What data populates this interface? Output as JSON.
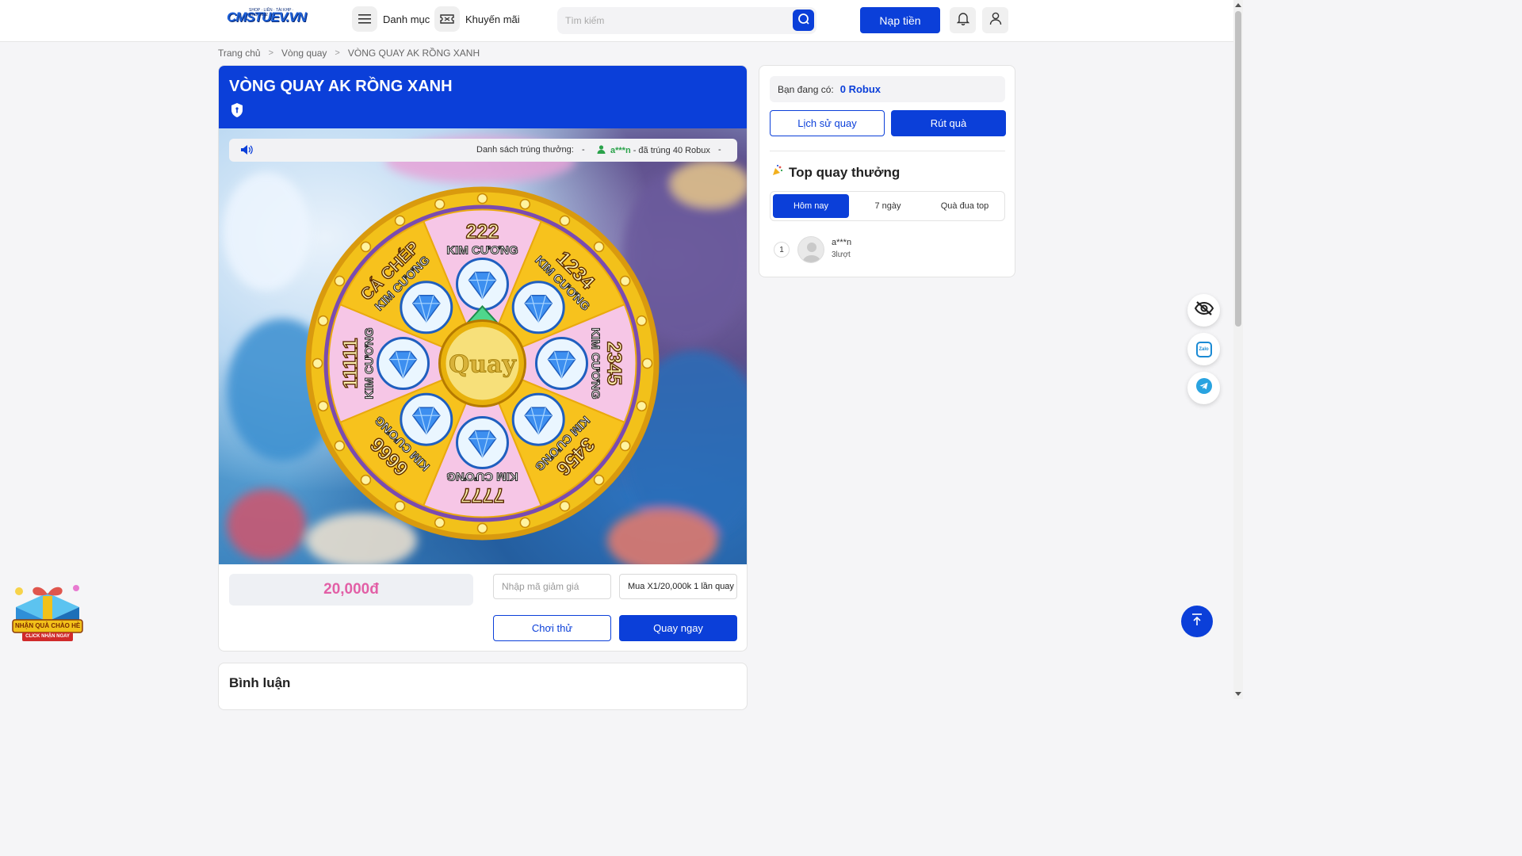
{
  "header": {
    "logo_text": "CMSTUEV.VN",
    "logo_sub": "SHOP · LIÊN · TÀI KHP · CHỢ 2022",
    "menu_label": "Danh mục",
    "promo_label": "Khuyến mãi",
    "search_placeholder": "Tìm kiếm",
    "topup_label": "Nạp tiền",
    "icons": [
      "menu-icon",
      "ticket-icon",
      "search-icon",
      "bell-icon",
      "user-icon"
    ]
  },
  "breadcrumb": {
    "items": [
      "Trang chủ",
      "Vòng quay",
      "VÒNG QUAY AK RỒNG XANH"
    ]
  },
  "main": {
    "title": "VÒNG QUAY AK RỒNG XANH",
    "ticker": {
      "label": "Danh sách trúng thưởng:",
      "dash": "-",
      "winner": "a***n",
      "prize_text": "- đã trúng 40 Robux"
    },
    "wheel": {
      "center_label": "Quay",
      "segments": [
        {
          "amount": "222",
          "unit": "KIM CƯƠNG",
          "color": "pink"
        },
        {
          "amount": "1234",
          "unit": "KIM CƯƠNG",
          "color": "yellow"
        },
        {
          "amount": "2345",
          "unit": "KIM CƯƠNG",
          "color": "pink"
        },
        {
          "amount": "3456",
          "unit": "KIM CƯƠNG",
          "color": "yellow"
        },
        {
          "amount": "7777",
          "unit": "KIM CƯƠNG",
          "color": "pink"
        },
        {
          "amount": "6666",
          "unit": "KIM CƯƠNG",
          "color": "yellow"
        },
        {
          "amount": "11111",
          "unit": "KIM CƯƠNG",
          "color": "pink"
        },
        {
          "amount": "CÁ CHÉP",
          "unit": "KIM CƯƠNG",
          "color": "yellow"
        }
      ],
      "colors": {
        "pink": "#f6c6e6",
        "yellow": "#f7c21d",
        "rim": "#f2c11a"
      }
    },
    "price": "20,000đ",
    "coupon_placeholder": "Nhập mã giảm giá",
    "buy_option": "Mua X1/20,000k 1 lần quay",
    "try_label": "Chơi thử",
    "spin_label": "Quay ngay"
  },
  "comments": {
    "title": "Bình luận"
  },
  "side": {
    "balance_label": "Bạn đang có:",
    "balance_value": "0 Robux",
    "history_label": "Lịch sử quay",
    "withdraw_label": "Rút quà",
    "top_title": "Top quay thưởng",
    "tabs": [
      "Hôm nay",
      "7 ngày",
      "Quà đua top"
    ],
    "active_tab": 0,
    "ranking": [
      {
        "rank": "1",
        "name": "a***n",
        "turns": "3lượt"
      }
    ]
  },
  "floating": {
    "icons": [
      "eye-off-icon",
      "zalo-icon",
      "telegram-icon",
      "arrow-up-icon"
    ],
    "zalo_text": "Zalo"
  },
  "gift_banner": {
    "line1": "NHẬN QUÀ CHÀO HÈ",
    "line2": "CLICK NHẬN NGAY"
  },
  "accent_color": "#0b3fd9"
}
